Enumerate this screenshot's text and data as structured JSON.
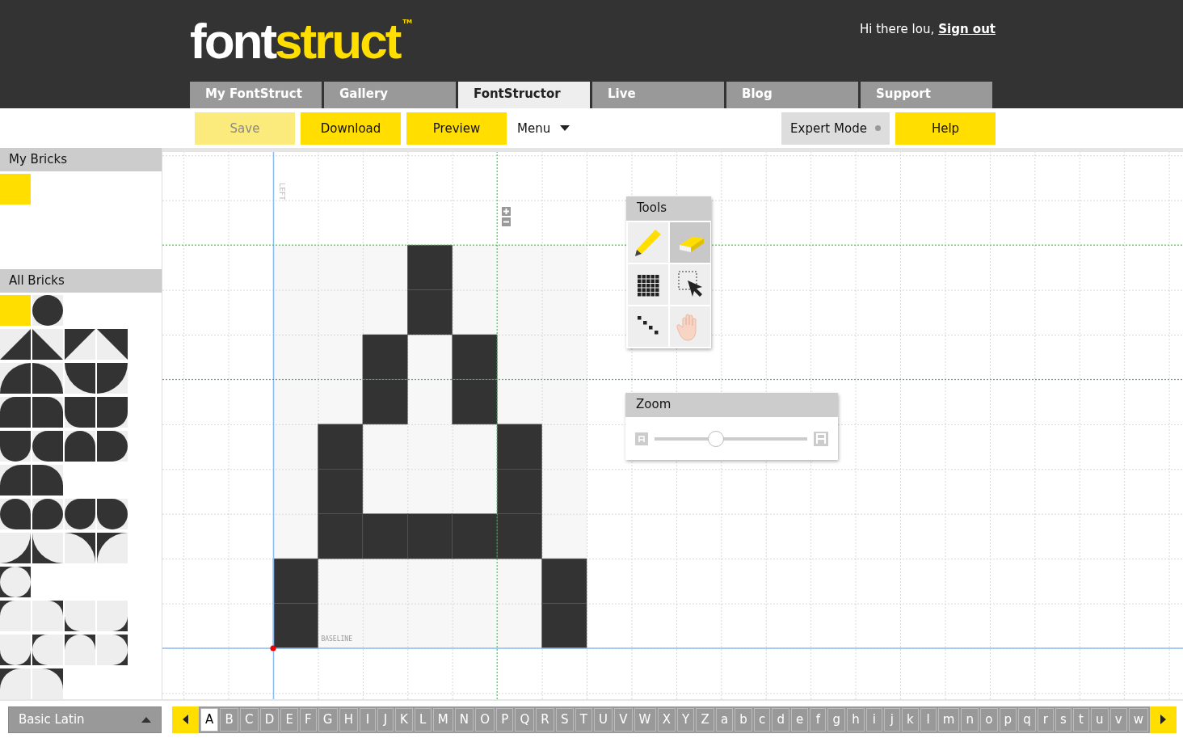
{
  "logo": {
    "part1": "font",
    "part2": "struct",
    "mark": "TM"
  },
  "greeting": {
    "text": "Hi there lou,",
    "link": "Sign out"
  },
  "tabs": [
    {
      "label": "My FontStruct",
      "selected": false
    },
    {
      "label": "Gallery",
      "selected": false
    },
    {
      "label": "FontStructor",
      "selected": true
    },
    {
      "label": "Live",
      "selected": false
    },
    {
      "label": "Blog",
      "selected": false
    },
    {
      "label": "Support",
      "selected": false
    }
  ],
  "toolbar": {
    "buttons": [
      {
        "label": "Save",
        "disabled": true
      },
      {
        "label": "Download",
        "disabled": false
      },
      {
        "label": "Preview",
        "disabled": false
      }
    ],
    "menu": "Menu",
    "expert_mode": {
      "label": "Expert Mode",
      "on": false
    },
    "help": "Help"
  },
  "sidebar": {
    "my_bricks": {
      "title": "My Bricks",
      "bricks": [
        {
          "kind": "solid",
          "inverted": false
        }
      ]
    },
    "all_bricks": {
      "title": "All Bricks",
      "rows": [
        [
          {
            "kind": "solid",
            "inverted": false
          },
          {
            "kind": "circle",
            "inverted": false
          }
        ],
        [
          {
            "kind": "tri-br",
            "inverted": false
          },
          {
            "kind": "tri-bl",
            "inverted": false
          },
          {
            "kind": "tri-tl",
            "inverted": false
          },
          {
            "kind": "tri-tr",
            "inverted": false
          }
        ],
        [
          {
            "kind": "quarter-tl",
            "inverted": false
          },
          {
            "kind": "quarter-tr",
            "inverted": false
          },
          {
            "kind": "quarter-bl",
            "inverted": false
          },
          {
            "kind": "quarter-br",
            "inverted": false
          }
        ],
        [
          {
            "kind": "round-tl",
            "inverted": false
          },
          {
            "kind": "round-tr",
            "inverted": false
          },
          {
            "kind": "round-bl",
            "inverted": false
          },
          {
            "kind": "round-br",
            "inverted": false
          }
        ],
        [
          {
            "kind": "half-bottom",
            "inverted": false
          },
          {
            "kind": "half-left",
            "inverted": false
          },
          {
            "kind": "half-top",
            "inverted": false
          },
          {
            "kind": "half-right",
            "inverted": false
          }
        ],
        [
          {
            "kind": "leaf-tl",
            "inverted": false
          },
          {
            "kind": "leaf-tr",
            "inverted": false
          }
        ],
        [
          {
            "kind": "three-br",
            "inverted": false
          },
          {
            "kind": "three-bl",
            "inverted": false
          },
          {
            "kind": "three-tr",
            "inverted": false
          },
          {
            "kind": "three-tl",
            "inverted": false
          }
        ],
        [
          {
            "kind": "quarter-br",
            "inverted": true
          },
          {
            "kind": "quarter-bl",
            "inverted": true
          },
          {
            "kind": "quarter-tr",
            "inverted": true
          },
          {
            "kind": "quarter-tl",
            "inverted": true
          }
        ],
        [
          {
            "kind": "circle",
            "inverted": true
          }
        ],
        [
          {
            "kind": "round-tl",
            "inverted": true
          },
          {
            "kind": "round-tr",
            "inverted": true
          },
          {
            "kind": "round-bl",
            "inverted": true
          },
          {
            "kind": "round-br",
            "inverted": true
          }
        ],
        [
          {
            "kind": "half-bottom",
            "inverted": true
          },
          {
            "kind": "half-left",
            "inverted": true
          },
          {
            "kind": "half-top",
            "inverted": true
          },
          {
            "kind": "half-right",
            "inverted": true
          }
        ],
        [
          {
            "kind": "leaf-tl",
            "inverted": true
          },
          {
            "kind": "leaf-tr",
            "inverted": true
          }
        ]
      ]
    }
  },
  "canvas": {
    "left_label": "LEFT",
    "baseline_label": "BASELINE",
    "glyph": {
      "rows": [
        [
          {
            "filled": false
          },
          {
            "filled": false
          },
          {
            "filled": false
          },
          {
            "filled": true
          },
          {
            "filled": false
          },
          {
            "filled": false
          },
          {
            "filled": false
          }
        ],
        [
          {
            "filled": false
          },
          {
            "filled": false
          },
          {
            "filled": false
          },
          {
            "filled": true
          },
          {
            "filled": false
          },
          {
            "filled": false
          },
          {
            "filled": false
          }
        ],
        [
          {
            "filled": false
          },
          {
            "filled": false
          },
          {
            "filled": true
          },
          {
            "filled": false
          },
          {
            "filled": true
          },
          {
            "filled": false
          },
          {
            "filled": false
          }
        ],
        [
          {
            "filled": false
          },
          {
            "filled": false
          },
          {
            "filled": true
          },
          {
            "filled": false
          },
          {
            "filled": true
          },
          {
            "filled": false
          },
          {
            "filled": false
          }
        ],
        [
          {
            "filled": false
          },
          {
            "filled": true
          },
          {
            "filled": false
          },
          {
            "filled": false
          },
          {
            "filled": false
          },
          {
            "filled": true
          },
          {
            "filled": false
          }
        ],
        [
          {
            "filled": false
          },
          {
            "filled": true
          },
          {
            "filled": false
          },
          {
            "filled": false
          },
          {
            "filled": false
          },
          {
            "filled": true
          },
          {
            "filled": false
          }
        ],
        [
          {
            "filled": false
          },
          {
            "filled": true
          },
          {
            "filled": true
          },
          {
            "filled": true
          },
          {
            "filled": true
          },
          {
            "filled": true
          },
          {
            "filled": false
          }
        ],
        [
          {
            "filled": true
          },
          {
            "filled": false
          },
          {
            "filled": false
          },
          {
            "filled": false
          },
          {
            "filled": false
          },
          {
            "filled": false
          },
          {
            "filled": true
          }
        ],
        [
          {
            "filled": true
          },
          {
            "filled": false
          },
          {
            "filled": false
          },
          {
            "filled": false
          },
          {
            "filled": false
          },
          {
            "filled": false
          },
          {
            "filled": true
          }
        ]
      ]
    }
  },
  "tools_panel": {
    "title": "Tools",
    "tools": [
      {
        "kind": "pencil",
        "selected": false
      },
      {
        "kind": "eraser",
        "selected": true
      },
      {
        "kind": "grid",
        "selected": false
      },
      {
        "kind": "select",
        "selected": false
      },
      {
        "kind": "line",
        "selected": false
      },
      {
        "kind": "hand",
        "selected": false
      }
    ]
  },
  "zoom_panel": {
    "title": "Zoom",
    "level": 0.39
  },
  "charset": {
    "label": "Basic Latin"
  },
  "letters": [
    {
      "label": "A",
      "selected": true
    },
    {
      "label": "B",
      "selected": false
    },
    {
      "label": "C",
      "selected": false
    },
    {
      "label": "D",
      "selected": false
    },
    {
      "label": "E",
      "selected": false
    },
    {
      "label": "F",
      "selected": false
    },
    {
      "label": "G",
      "selected": false
    },
    {
      "label": "H",
      "selected": false
    },
    {
      "label": "I",
      "selected": false
    },
    {
      "label": "J",
      "selected": false
    },
    {
      "label": "K",
      "selected": false
    },
    {
      "label": "L",
      "selected": false
    },
    {
      "label": "M",
      "selected": false
    },
    {
      "label": "N",
      "selected": false
    },
    {
      "label": "O",
      "selected": false
    },
    {
      "label": "P",
      "selected": false
    },
    {
      "label": "Q",
      "selected": false
    },
    {
      "label": "R",
      "selected": false
    },
    {
      "label": "S",
      "selected": false
    },
    {
      "label": "T",
      "selected": false
    },
    {
      "label": "U",
      "selected": false
    },
    {
      "label": "V",
      "selected": false
    },
    {
      "label": "W",
      "selected": false
    },
    {
      "label": "X",
      "selected": false
    },
    {
      "label": "Y",
      "selected": false
    },
    {
      "label": "Z",
      "selected": false
    },
    {
      "label": "a",
      "selected": false
    },
    {
      "label": "b",
      "selected": false
    },
    {
      "label": "c",
      "selected": false
    },
    {
      "label": "d",
      "selected": false
    },
    {
      "label": "e",
      "selected": false
    },
    {
      "label": "f",
      "selected": false
    },
    {
      "label": "g",
      "selected": false
    },
    {
      "label": "h",
      "selected": false
    },
    {
      "label": "i",
      "selected": false
    },
    {
      "label": "j",
      "selected": false
    },
    {
      "label": "k",
      "selected": false
    },
    {
      "label": "l",
      "selected": false
    },
    {
      "label": "m",
      "selected": false
    },
    {
      "label": "n",
      "selected": false
    },
    {
      "label": "o",
      "selected": false
    },
    {
      "label": "p",
      "selected": false
    },
    {
      "label": "q",
      "selected": false
    },
    {
      "label": "r",
      "selected": false
    },
    {
      "label": "s",
      "selected": false
    },
    {
      "label": "t",
      "selected": false
    },
    {
      "label": "u",
      "selected": false
    },
    {
      "label": "v",
      "selected": false
    },
    {
      "label": "w",
      "selected": false
    }
  ]
}
